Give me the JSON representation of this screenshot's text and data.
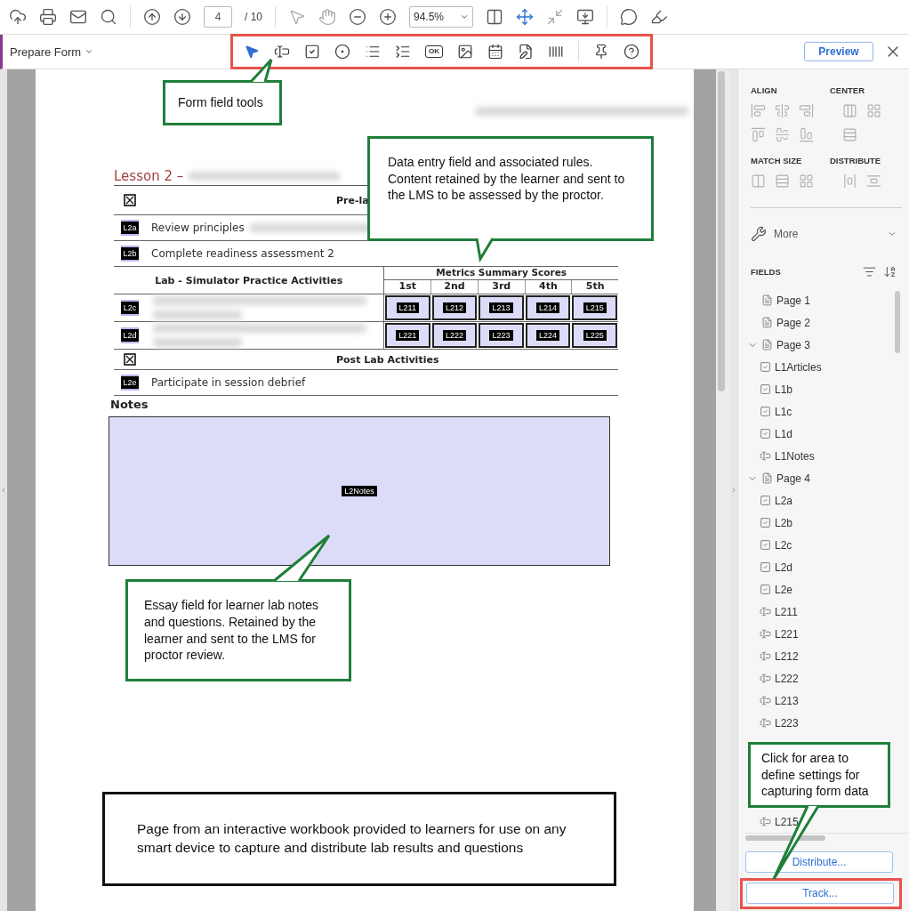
{
  "toolbar": {
    "page_number": "4",
    "page_total": "/ 10",
    "zoom": "94.5%"
  },
  "form_bar": {
    "title": "Prepare Form",
    "ok_icon_label": "OK",
    "preview": "Preview"
  },
  "document": {
    "lesson_title": "Lesson 2 –",
    "rows": [
      {
        "kind": "section",
        "title": "Pre-la"
      },
      {
        "kind": "task",
        "badge": "L2a",
        "text": "Review principles",
        "blurred": true
      },
      {
        "kind": "task",
        "badge": "L2b",
        "text": "Complete readiness assessment 2"
      },
      {
        "kind": "metrics_header",
        "title": "Lab - Simulator Practice Activities",
        "metrics_title": "Metrics Summary Scores",
        "columns": [
          "1st",
          "2nd",
          "3rd",
          "4th",
          "5th"
        ]
      },
      {
        "kind": "scores",
        "badge": "L2c",
        "fields": [
          "L211",
          "L212",
          "L213",
          "L214",
          "L215"
        ]
      },
      {
        "kind": "scores",
        "badge": "L2d",
        "fields": [
          "L221",
          "L222",
          "L223",
          "L224",
          "L225"
        ]
      },
      {
        "kind": "section",
        "title": "Post Lab Activities"
      },
      {
        "kind": "task",
        "badge": "L2e",
        "text": "Participate in session debrief"
      }
    ],
    "notes_title": "Notes",
    "notes_field": "L2Notes"
  },
  "panel": {
    "align": "ALIGN",
    "center": "CENTER",
    "match_size": "MATCH SIZE",
    "distribute": "DISTRIBUTE",
    "more": "More",
    "fields_title": "FIELDS",
    "tree": [
      {
        "label": "Page 1",
        "kind": "page"
      },
      {
        "label": "Page 2",
        "kind": "page"
      },
      {
        "label": "Page 3",
        "kind": "page",
        "children": [
          {
            "label": "L1Articles",
            "kind": "checkbox"
          },
          {
            "label": "L1b",
            "kind": "checkbox"
          },
          {
            "label": "L1c",
            "kind": "checkbox"
          },
          {
            "label": "L1d",
            "kind": "checkbox"
          },
          {
            "label": "L1Notes",
            "kind": "text"
          }
        ]
      },
      {
        "label": "Page 4",
        "kind": "page",
        "children": [
          {
            "label": "L2a",
            "kind": "checkbox"
          },
          {
            "label": "L2b",
            "kind": "checkbox"
          },
          {
            "label": "L2c",
            "kind": "checkbox"
          },
          {
            "label": "L2d",
            "kind": "checkbox"
          },
          {
            "label": "L2e",
            "kind": "checkbox"
          },
          {
            "label": "L211",
            "kind": "text"
          },
          {
            "label": "L221",
            "kind": "text"
          },
          {
            "label": "L212",
            "kind": "text"
          },
          {
            "label": "L222",
            "kind": "text"
          },
          {
            "label": "L213",
            "kind": "text"
          },
          {
            "label": "L223",
            "kind": "text"
          },
          {
            "label": "L215",
            "kind": "text"
          }
        ]
      }
    ],
    "distribute_button": "Distribute...",
    "track_button": "Track..."
  },
  "callouts": [
    {
      "kind": "green",
      "text": "Form field tools"
    },
    {
      "kind": "green",
      "text": "Data entry field and associated rules. Content retained by the learner and sent to the LMS to be assessed by the proctor."
    },
    {
      "kind": "green",
      "text": "Essay field for learner lab notes and questions. Retained by the learner and sent to the LMS  for proctor review."
    },
    {
      "kind": "black",
      "text": "Page from an interactive workbook provided to learners for use on any smart device to capture and distribute lab results and questions"
    },
    {
      "kind": "green",
      "text": "Click for area to define settings for capturing form data"
    }
  ]
}
